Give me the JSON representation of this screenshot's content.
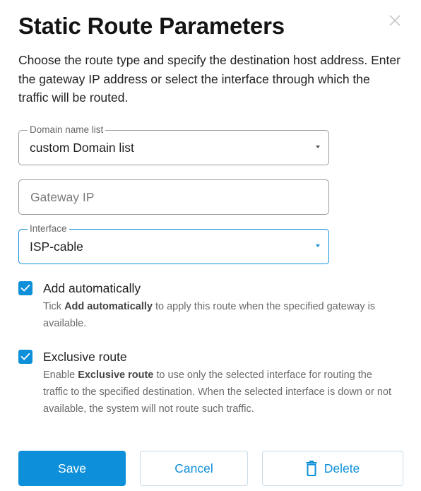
{
  "dialog": {
    "title": "Static Route Parameters",
    "description": "Choose the route type and specify the destination host address. Enter the gateway IP address or select the interface through which the traffic will be routed."
  },
  "domain_list": {
    "label": "Domain name list",
    "value": "custom Domain list"
  },
  "gateway": {
    "placeholder": "Gateway IP",
    "value": ""
  },
  "interface": {
    "label": "Interface",
    "value": "ISP-cable"
  },
  "add_automatically": {
    "label": "Add automatically",
    "checked": true,
    "help_prefix": "Tick ",
    "help_bold": "Add automatically",
    "help_suffix": " to apply this route when the specified gateway is available."
  },
  "exclusive_route": {
    "label": "Exclusive route",
    "checked": true,
    "help_prefix": "Enable ",
    "help_bold": "Exclusive route",
    "help_suffix": " to use only the selected interface for routing the traffic to the specified destination. When the selected interface is down or not available, the system will not route such traffic."
  },
  "buttons": {
    "save": "Save",
    "cancel": "Cancel",
    "delete": "Delete"
  },
  "icons": {
    "close": "close-icon",
    "checkbox": "checkmark-icon",
    "delete": "trash-icon",
    "dropdown": "caret-down-icon"
  },
  "colors": {
    "accent": "#0e8fd9",
    "title": "#141414",
    "help_text": "#6a6a6a"
  }
}
